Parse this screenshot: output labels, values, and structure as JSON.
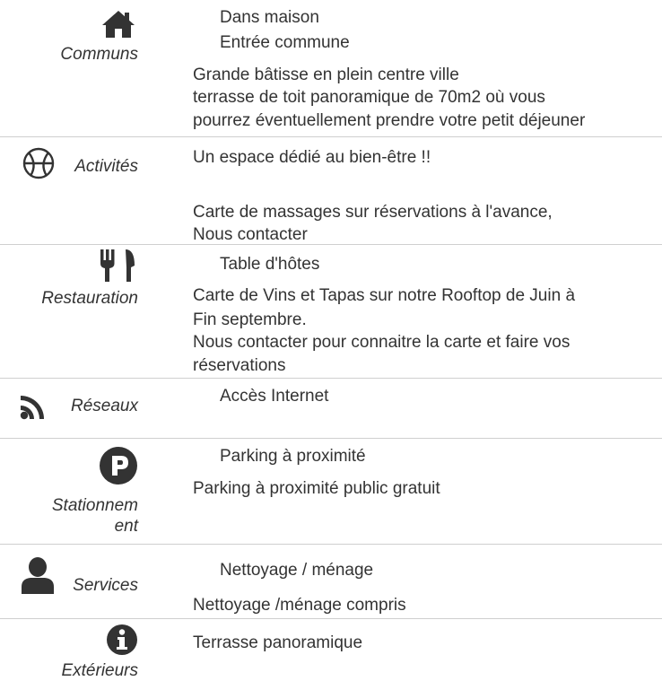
{
  "sections": [
    {
      "icon": "home-icon",
      "label": "Communs",
      "sub_items": [
        "Dans maison",
        "Entrée commune"
      ],
      "description": [
        "Grande bâtisse en plein centre ville",
        "terrasse de toit panoramique de 70m2 où vous",
        "pourrez éventuellement prendre votre petit déjeuner"
      ]
    },
    {
      "icon": "basketball-icon",
      "label": "Activités",
      "description": [
        "Un espace dédié au bien-être !!",
        "",
        "Carte de massages sur réservations à l'avance,",
        "Nous contacter"
      ]
    },
    {
      "icon": "utensils-icon",
      "label": "Restauration",
      "sub_items": [
        "Table d'hôtes"
      ],
      "description": [
        "Carte de Vins et Tapas sur notre Rooftop de Juin à",
        "Fin septembre.",
        "Nous contacter pour connaitre la carte et faire vos",
        "réservations"
      ]
    },
    {
      "icon": "rss-icon",
      "label": "Réseaux",
      "sub_items": [
        "Accès Internet"
      ]
    },
    {
      "icon": "parking-icon",
      "label_lines": [
        "Stationnem",
        "ent"
      ],
      "sub_items": [
        "Parking à proximité"
      ],
      "description": [
        "Parking à proximité public gratuit"
      ]
    },
    {
      "icon": "user-icon",
      "label": "Services",
      "sub_items": [
        "Nettoyage / ménage"
      ],
      "description": [
        "Nettoyage /ménage compris"
      ]
    },
    {
      "icon": "info-icon",
      "label": "Extérieurs",
      "description": [
        "Terrasse panoramique"
      ]
    }
  ]
}
